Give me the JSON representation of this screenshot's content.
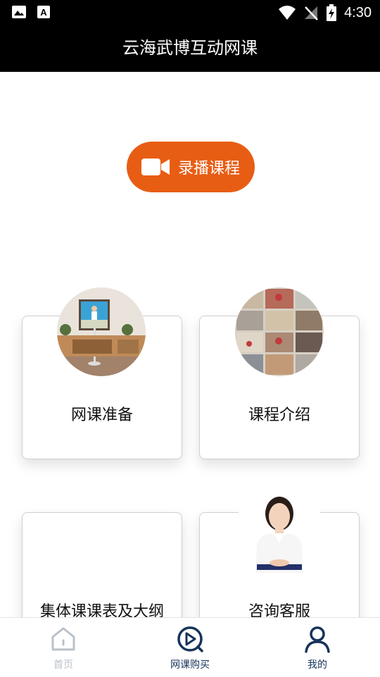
{
  "status_bar": {
    "time": "4:30"
  },
  "title": "云海武博互动网课",
  "record_button": {
    "label": "录播课程"
  },
  "cards": [
    {
      "label": "网课准备"
    },
    {
      "label": "课程介绍"
    },
    {
      "label": "集体课课表及大纲"
    },
    {
      "label": "咨询客服"
    }
  ],
  "bottom_nav": [
    {
      "label": "首页"
    },
    {
      "label": "网课购买"
    },
    {
      "label": "我的"
    }
  ],
  "colors": {
    "accent": "#e85d14",
    "nav_active": "#16335a",
    "nav_inactive": "#b9c1ca"
  }
}
